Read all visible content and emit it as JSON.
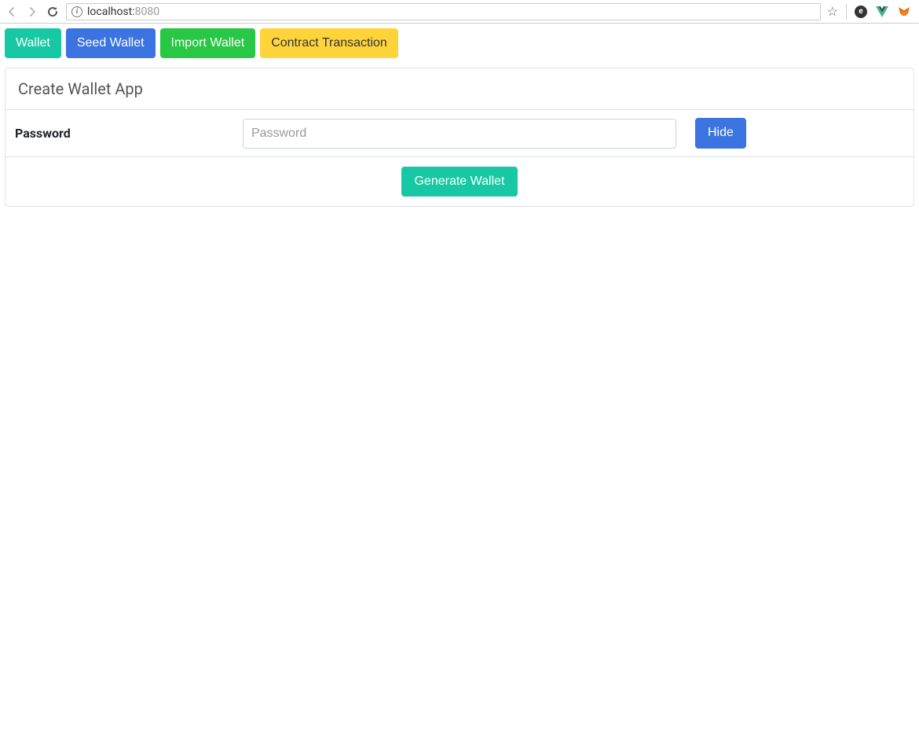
{
  "browser": {
    "url_host": "localhost:",
    "url_port": "8080"
  },
  "tabs": {
    "wallet": "Wallet",
    "seed_wallet": "Seed Wallet",
    "import_wallet": "Import Wallet",
    "contract_transaction": "Contract Transaction"
  },
  "card": {
    "title": "Create Wallet App",
    "password_label": "Password",
    "password_placeholder": "Password",
    "hide_button": "Hide",
    "generate_button": "Generate Wallet"
  }
}
